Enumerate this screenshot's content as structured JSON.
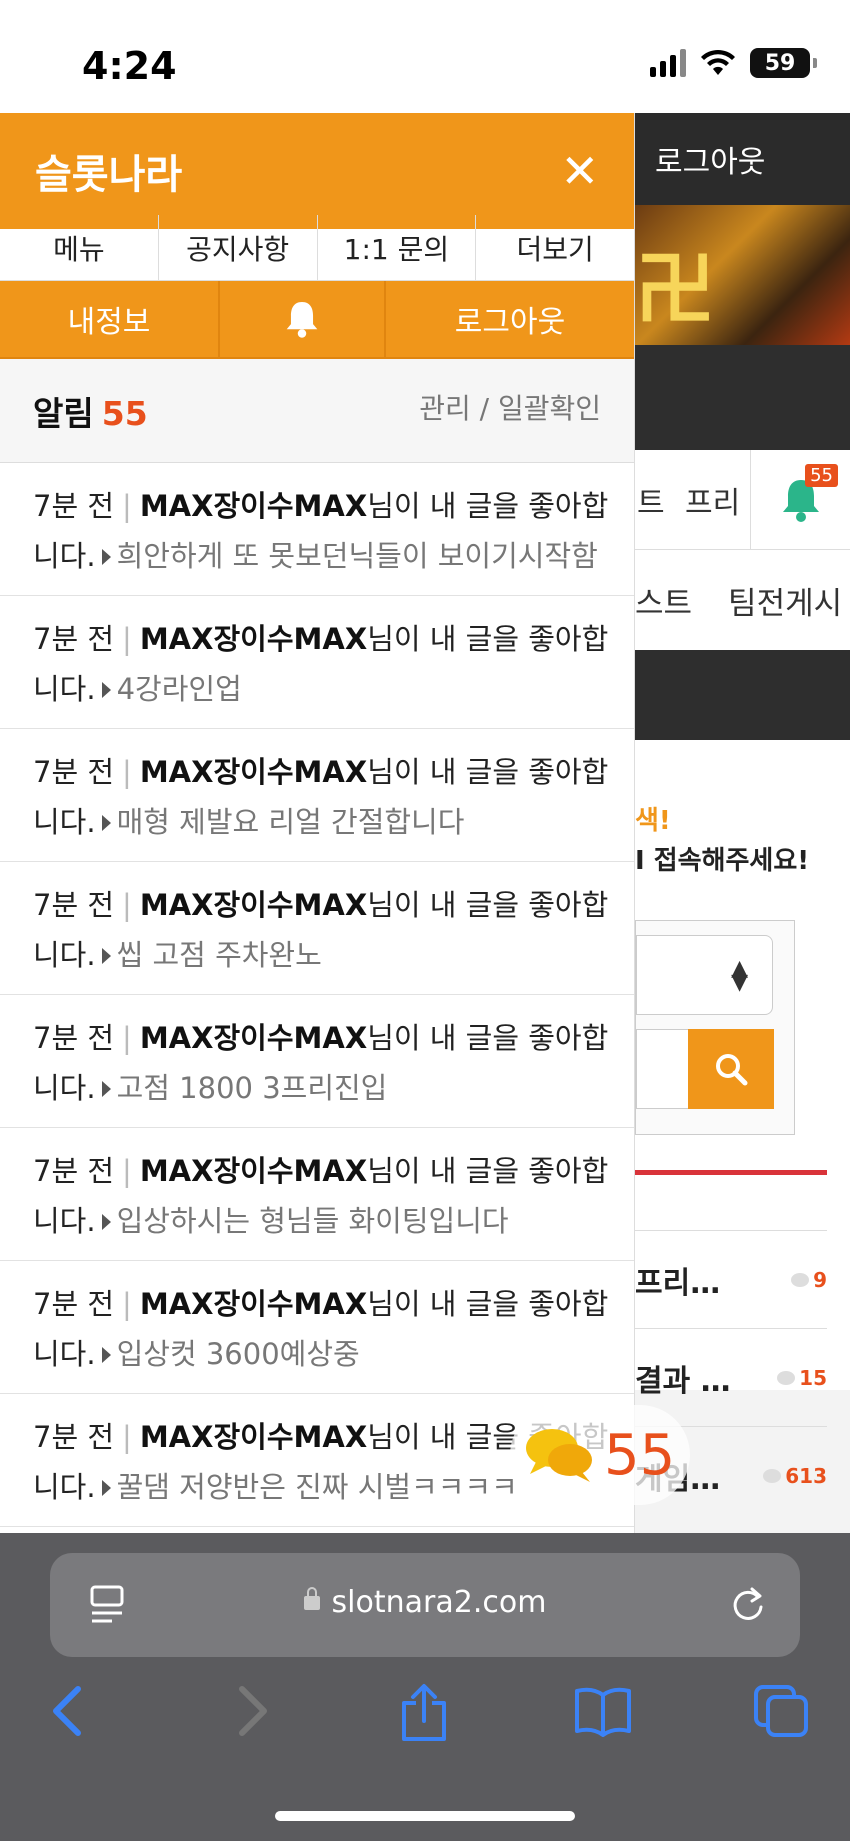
{
  "status": {
    "time": "4:24",
    "battery": "59"
  },
  "background": {
    "topbar_logout": "로그아웃",
    "nav_partial_1": "트",
    "nav_partial_2": "프리",
    "bell_badge": "55",
    "tab_partial_1": "스트",
    "tab_partial_2": "팀전게시",
    "notice_line1": "색!",
    "notice_line2": "I 접속해주세요!",
    "list": [
      {
        "title": "프리…",
        "count": "9"
      },
      {
        "title": "결과 …",
        "count": "15"
      },
      {
        "title": "게임…",
        "count": "613"
      }
    ]
  },
  "panel": {
    "title": "슬롯나라",
    "menu": [
      "메뉴",
      "공지사항",
      "1:1 문의",
      "더보기"
    ],
    "actions": {
      "my_info": "내정보",
      "logout": "로그아웃"
    },
    "alarm": {
      "label": "알림",
      "count": "55",
      "manage": "관리 / 일괄확인"
    },
    "notifications": [
      {
        "time": "7분 전",
        "user": "MAX장이수MAX",
        "msg1": "님이 내 글을 좋아합",
        "msg2": "니다.",
        "post": "희안하게 또 못보던닉들이 보이기시작함"
      },
      {
        "time": "7분 전",
        "user": "MAX장이수MAX",
        "msg1": "님이 내 글을 좋아합",
        "msg2": "니다.",
        "post": "4강라인업"
      },
      {
        "time": "7분 전",
        "user": "MAX장이수MAX",
        "msg1": "님이 내 글을 좋아합",
        "msg2": "니다.",
        "post": "매형 제발요 리얼 간절합니다"
      },
      {
        "time": "7분 전",
        "user": "MAX장이수MAX",
        "msg1": "님이 내 글을 좋아합",
        "msg2": "니다.",
        "post": "씹 고점 주차완노"
      },
      {
        "time": "7분 전",
        "user": "MAX장이수MAX",
        "msg1": "님이 내 글을 좋아합",
        "msg2": "니다.",
        "post": "고점 1800 3프리진입"
      },
      {
        "time": "7분 전",
        "user": "MAX장이수MAX",
        "msg1": "님이 내 글을 좋아합",
        "msg2": "니다.",
        "post": "입상하시는 형님들 화이팅입니다"
      },
      {
        "time": "7분 전",
        "user": "MAX장이수MAX",
        "msg1": "님이 내 글을 좋아합",
        "msg2": "니다.",
        "post": "입상컷 3600예상중"
      },
      {
        "time": "7분 전",
        "user": "MAX장이수MAX",
        "msg1": "님이 내 글을 좋아합",
        "msg2": "니다.",
        "post": "꿀댐 저양반은 진짜 시벌ㅋㅋㅋㅋ"
      }
    ]
  },
  "floating_chat": {
    "count": "55"
  },
  "browser": {
    "url": "slotnara2.com"
  },
  "colors": {
    "accent": "#f0961a",
    "count_red": "#e8501c",
    "browser_blue": "#3b82f6"
  }
}
